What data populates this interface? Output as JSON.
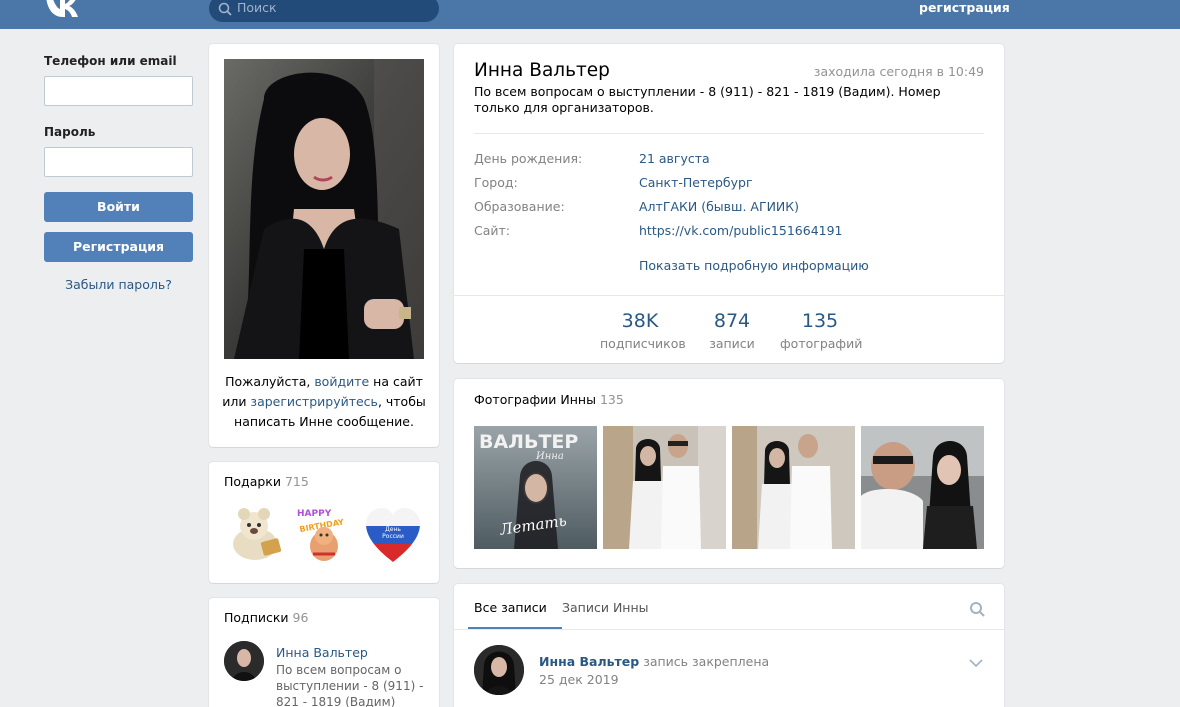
{
  "header": {
    "search_placeholder": "Поиск",
    "register_label": "регистрация"
  },
  "login": {
    "phone_label": "Телефон или email",
    "password_label": "Пароль",
    "login_button": "Войти",
    "register_button": "Регистрация",
    "forgot_link": "Забыли пароль?"
  },
  "avatar": {
    "msg_prefix": "Пожалуйста, ",
    "msg_login": "войдите",
    "msg_mid": " на сайт или ",
    "msg_register": "зарегистрируйтесь",
    "msg_suffix": ", чтобы написать Инне сообщение."
  },
  "gifts": {
    "title": "Подарки",
    "count": "715",
    "items": [
      "teddy-bear-gift",
      "happy-birthday-gift",
      "russia-day-heart-gift"
    ],
    "russia_heart_text": "День России",
    "happy_text": "HAPPY BIRTHDAY"
  },
  "subscriptions": {
    "title": "Подписки",
    "count": "96",
    "items": [
      {
        "name": "Инна Вальтер",
        "desc": "По всем вопросам о выступлении - 8 (911) - 821 - 1819 (Вадим)"
      }
    ]
  },
  "profile": {
    "name": "Инна Вальтер",
    "online": "заходила сегодня в 10:49",
    "status": "По всем вопросам о выступлении - 8 (911) - 821 - 1819 (Вадим). Номер только для организаторов.",
    "fields": [
      {
        "key": "День рождения:",
        "value": "21 августа"
      },
      {
        "key": "Город:",
        "value": "Санкт-Петербург"
      },
      {
        "key": "Образование:",
        "value": "АлтГАКИ (бывш. АГИИК)"
      },
      {
        "key": "Сайт:",
        "value": "https://vk.com/public151664191"
      }
    ],
    "show_more": "Показать подробную информацию",
    "counters": [
      {
        "number": "38K",
        "label": "подписчиков"
      },
      {
        "number": "874",
        "label": "записи"
      },
      {
        "number": "135",
        "label": "фотографий"
      }
    ]
  },
  "photos": {
    "title": "Фотографии Инны",
    "count": "135",
    "cover_title": "ВАЛЬТЕР",
    "cover_sub": "Инна",
    "cover_caption": "Летать"
  },
  "wall": {
    "tab_all": "Все записи",
    "tab_own": "Записи Инны",
    "post": {
      "author": "Инна Вальтер",
      "pinned": "запись закреплена",
      "date": "25 дек 2019"
    }
  },
  "colors": {
    "header": "#4a76a8",
    "button": "#5181b8",
    "link": "#2a5885",
    "background": "#edeef0"
  }
}
